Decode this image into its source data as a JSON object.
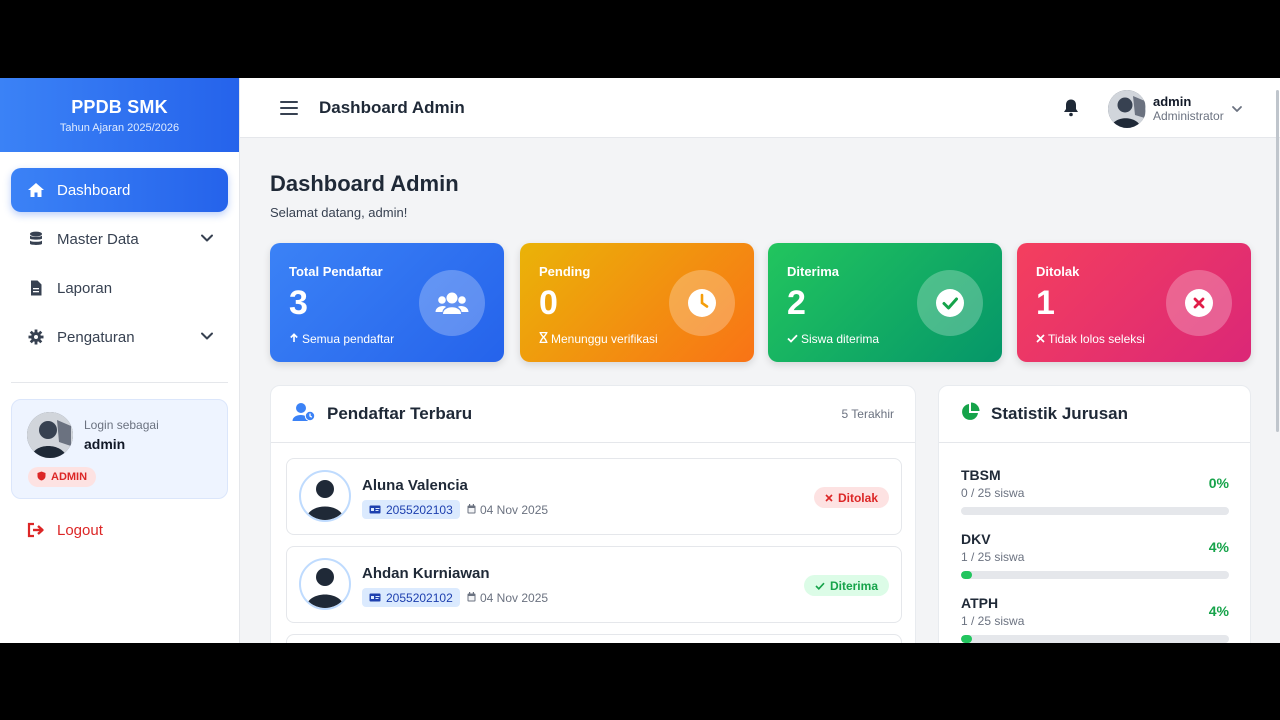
{
  "brand": {
    "title": "PPDB SMK",
    "subtitle": "Tahun Ajaran 2025/2026"
  },
  "sidebar": {
    "items": [
      {
        "label": "Dashboard",
        "icon": "home-icon",
        "active": true
      },
      {
        "label": "Master Data",
        "icon": "database-icon",
        "has_submenu": true
      },
      {
        "label": "Laporan",
        "icon": "file-icon"
      },
      {
        "label": "Pengaturan",
        "icon": "gear-icon",
        "has_submenu": true
      }
    ],
    "login": {
      "label": "Login sebagai",
      "username": "admin",
      "role_badge": "ADMIN"
    },
    "logout_label": "Logout"
  },
  "topbar": {
    "title": "Dashboard Admin",
    "user_name": "admin",
    "user_role": "Administrator"
  },
  "page": {
    "title": "Dashboard Admin",
    "subtitle": "Selamat datang, admin!"
  },
  "stats": [
    {
      "label": "Total Pendaftar",
      "value": "3",
      "footer": "Semua pendaftar",
      "icon": "users-icon",
      "color": "#3b82f6"
    },
    {
      "label": "Pending",
      "value": "0",
      "footer": "Menunggu verifikasi",
      "icon": "clock-icon",
      "color": "#f59e0b"
    },
    {
      "label": "Diterima",
      "value": "2",
      "footer": "Siswa diterima",
      "icon": "check-circle-icon",
      "color": "#16a34a"
    },
    {
      "label": "Ditolak",
      "value": "1",
      "footer": "Tidak lolos seleksi",
      "icon": "x-circle-icon",
      "color": "#e11d48"
    }
  ],
  "recent": {
    "title": "Pendaftar Terbaru",
    "meta": "5 Terakhir",
    "rows": [
      {
        "name": "Aluna Valencia",
        "id": "2055202103",
        "date": "04 Nov 2025",
        "status": "Ditolak"
      },
      {
        "name": "Ahdan Kurniawan",
        "id": "2055202102",
        "date": "04 Nov 2025",
        "status": "Diterima"
      }
    ]
  },
  "majors": {
    "title": "Statistik Jurusan",
    "items": [
      {
        "name": "TBSM",
        "count": "0 / 25 siswa",
        "percent": "0%",
        "fill": 0
      },
      {
        "name": "DKV",
        "count": "1 / 25 siswa",
        "percent": "4%",
        "fill": 4
      },
      {
        "name": "ATPH",
        "count": "1 / 25 siswa",
        "percent": "4%",
        "fill": 4
      }
    ]
  }
}
